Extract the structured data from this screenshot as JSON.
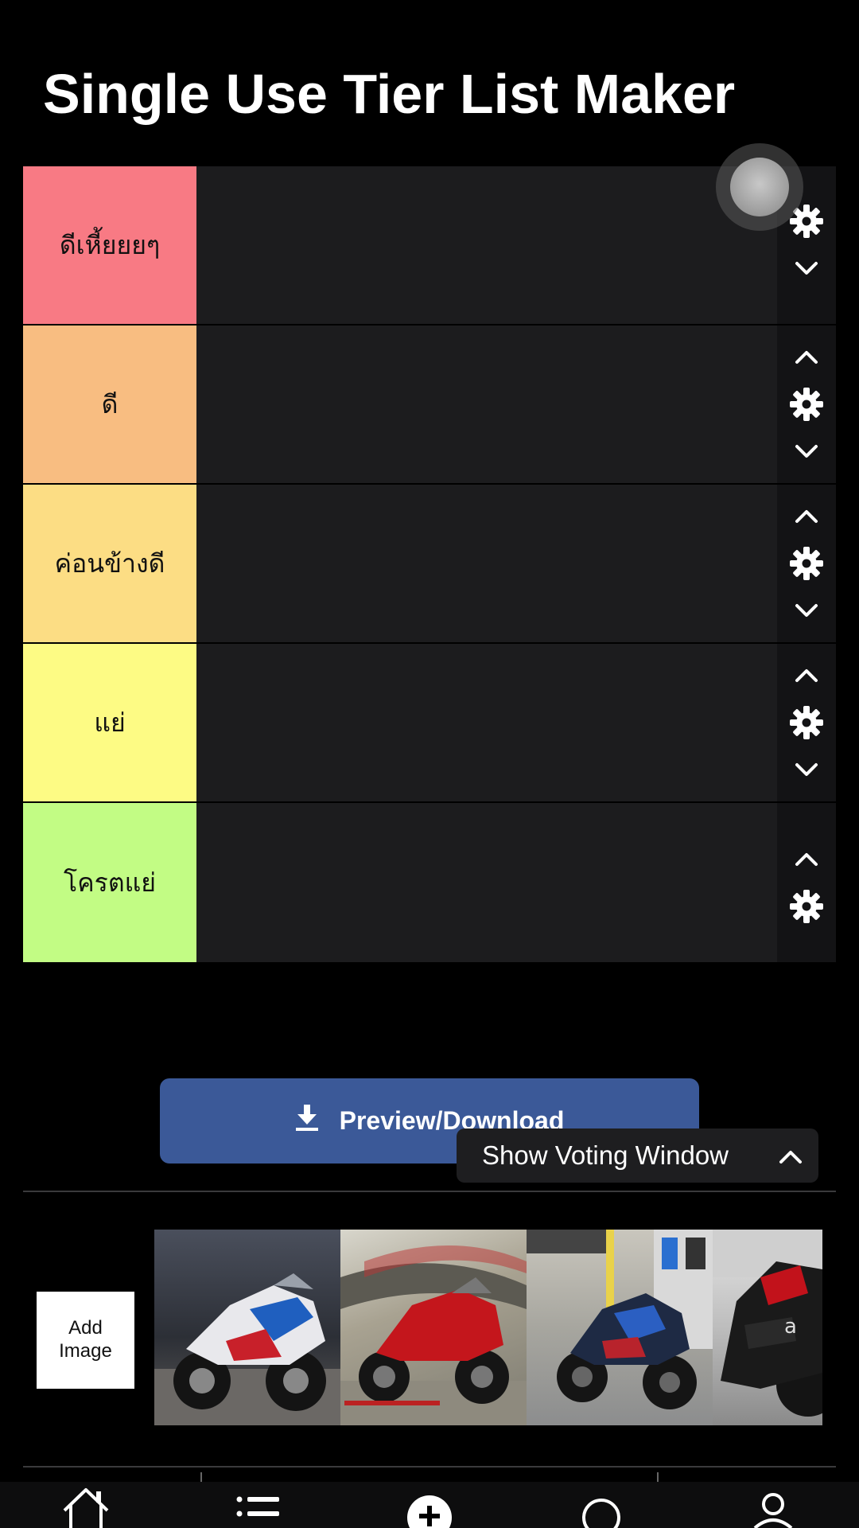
{
  "app": {
    "title": "Single Use Tier List Maker"
  },
  "tiers": [
    {
      "label": "ดีเหี้ยยยๆ",
      "color": "#f87a84",
      "has_up": false,
      "has_down": true
    },
    {
      "label": "ดี",
      "color": "#f8bd81",
      "has_up": true,
      "has_down": true
    },
    {
      "label": "ค่อนข้างดี",
      "color": "#fcdd84",
      "has_up": true,
      "has_down": true
    },
    {
      "label": "แย่",
      "color": "#fdfb84",
      "has_up": true,
      "has_down": true
    },
    {
      "label": "โครตแย่",
      "color": "#c2fc84",
      "has_up": true,
      "has_down": false
    }
  ],
  "actions": {
    "download_label": "Preview/Download",
    "voting_label": "Show Voting Window"
  },
  "gallery": {
    "add_image_label": "Add Image",
    "images": [
      {
        "name": "bmw-m1000rr-photo",
        "bg": "#3a3d46"
      },
      {
        "name": "ducati-panigale-photo",
        "bg": "#8a8570"
      },
      {
        "name": "bmw-m1000rr-station-photo",
        "bg": "#8c8d90"
      },
      {
        "name": "aprilia-rsv4-photo",
        "bg": "#5a5a5a"
      }
    ]
  },
  "bottom_nav": [
    "home-icon",
    "list-icon",
    "add-icon",
    "search-icon",
    "profile-icon"
  ],
  "colors": {
    "accent_button": "#3b5998",
    "tier_area": "#1c1c1e"
  }
}
